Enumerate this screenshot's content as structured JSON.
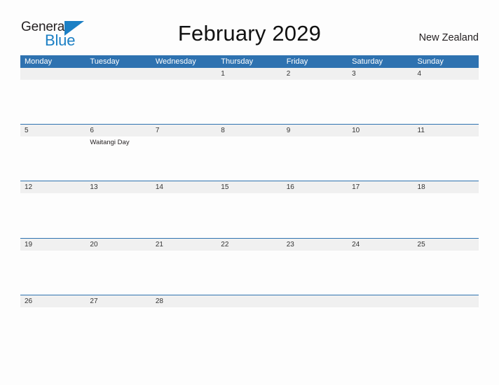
{
  "brand": {
    "name_part1": "General",
    "name_part2": "Blue",
    "triangle_icon": "triangle-icon",
    "accent_color": "#1b7fc4",
    "text_color": "#231f20"
  },
  "header": {
    "title": "February 2029",
    "region": "New Zealand"
  },
  "theme": {
    "header_blue": "#2e72b0",
    "rule_blue": "#2e72b0",
    "band_gray": "#f0f0f0",
    "page_background": "#fdfdfd",
    "day_number_color": "#333333"
  },
  "calendar": {
    "month": "February",
    "year": "2029",
    "weekday_headers": [
      "Monday",
      "Tuesday",
      "Wednesday",
      "Thursday",
      "Friday",
      "Saturday",
      "Sunday"
    ],
    "weeks": [
      {
        "days": [
          {
            "number": "",
            "event": ""
          },
          {
            "number": "",
            "event": ""
          },
          {
            "number": "",
            "event": ""
          },
          {
            "number": "1",
            "event": ""
          },
          {
            "number": "2",
            "event": ""
          },
          {
            "number": "3",
            "event": ""
          },
          {
            "number": "4",
            "event": ""
          }
        ]
      },
      {
        "days": [
          {
            "number": "5",
            "event": ""
          },
          {
            "number": "6",
            "event": "Waitangi Day"
          },
          {
            "number": "7",
            "event": ""
          },
          {
            "number": "8",
            "event": ""
          },
          {
            "number": "9",
            "event": ""
          },
          {
            "number": "10",
            "event": ""
          },
          {
            "number": "11",
            "event": ""
          }
        ]
      },
      {
        "days": [
          {
            "number": "12",
            "event": ""
          },
          {
            "number": "13",
            "event": ""
          },
          {
            "number": "14",
            "event": ""
          },
          {
            "number": "15",
            "event": ""
          },
          {
            "number": "16",
            "event": ""
          },
          {
            "number": "17",
            "event": ""
          },
          {
            "number": "18",
            "event": ""
          }
        ]
      },
      {
        "days": [
          {
            "number": "19",
            "event": ""
          },
          {
            "number": "20",
            "event": ""
          },
          {
            "number": "21",
            "event": ""
          },
          {
            "number": "22",
            "event": ""
          },
          {
            "number": "23",
            "event": ""
          },
          {
            "number": "24",
            "event": ""
          },
          {
            "number": "25",
            "event": ""
          }
        ]
      },
      {
        "days": [
          {
            "number": "26",
            "event": ""
          },
          {
            "number": "27",
            "event": ""
          },
          {
            "number": "28",
            "event": ""
          },
          {
            "number": "",
            "event": ""
          },
          {
            "number": "",
            "event": ""
          },
          {
            "number": "",
            "event": ""
          },
          {
            "number": "",
            "event": ""
          }
        ]
      }
    ]
  }
}
